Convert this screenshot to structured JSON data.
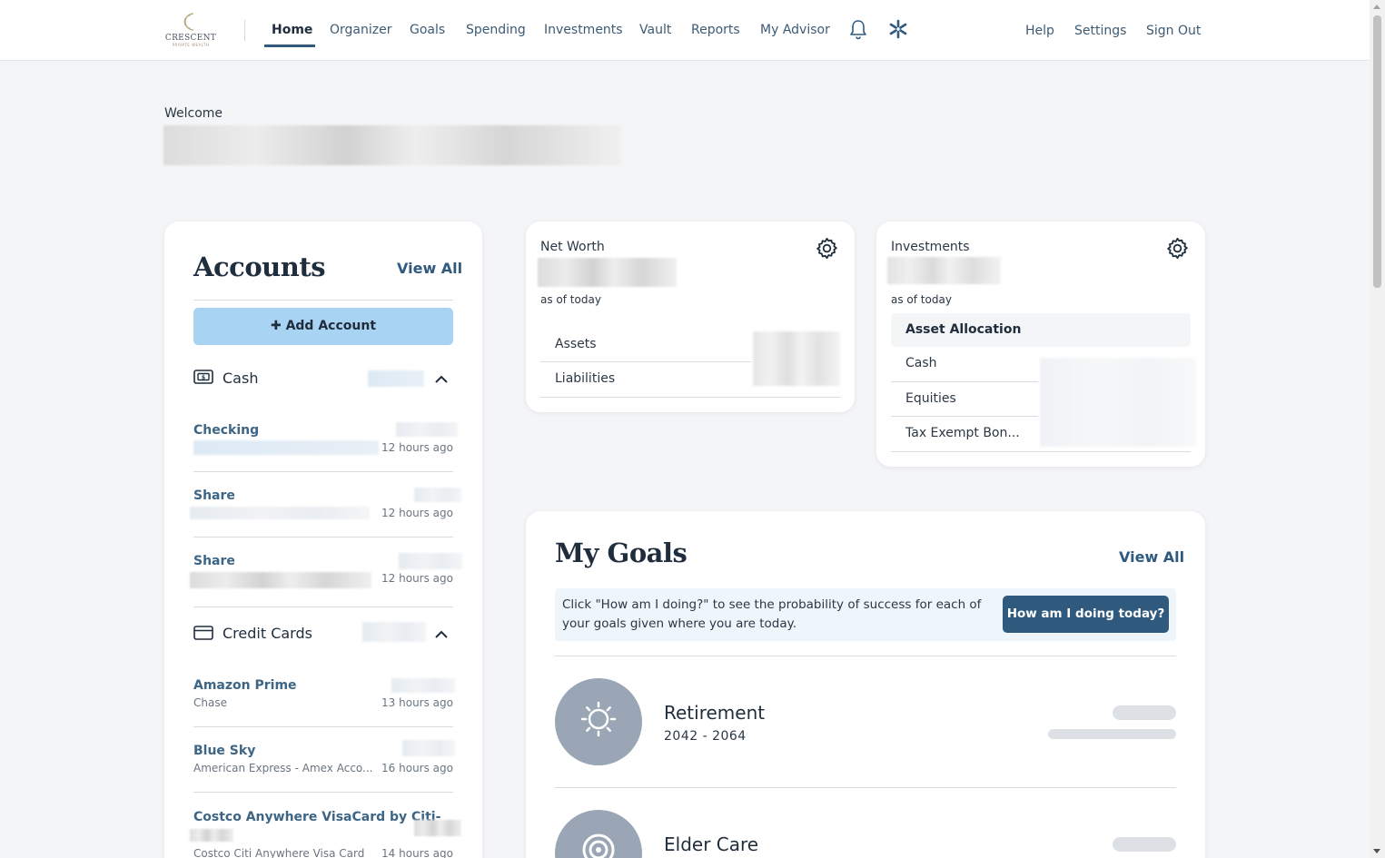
{
  "nav": {
    "logo_text": "CRESCENT",
    "logo_sub": "PRIVATE WEALTH",
    "items": [
      {
        "label": "Home"
      },
      {
        "label": "Organizer"
      },
      {
        "label": "Goals"
      },
      {
        "label": "Spending"
      },
      {
        "label": "Investments"
      },
      {
        "label": "Vault"
      },
      {
        "label": "Reports"
      },
      {
        "label": "My Advisor"
      }
    ],
    "right": [
      {
        "label": "Help"
      },
      {
        "label": "Settings"
      },
      {
        "label": "Sign Out"
      }
    ],
    "icons": [
      "bell-icon",
      "asterisk-icon"
    ]
  },
  "welcome": {
    "label": "Welcome"
  },
  "accounts": {
    "title": "Accounts",
    "view_all": "View All",
    "add_label": "Add Account",
    "groups": [
      {
        "name": "Cash",
        "items": [
          {
            "name": "Checking",
            "time": "12 hours ago"
          },
          {
            "name": "Share",
            "time": "12 hours ago"
          },
          {
            "name": "Share",
            "time": "12 hours ago"
          }
        ]
      },
      {
        "name": "Credit Cards",
        "items": [
          {
            "name": "Amazon Prime",
            "sub": "Chase",
            "time": "13 hours ago"
          },
          {
            "name": "Blue Sky",
            "sub": "American Express - Amex Acco...",
            "time": "16 hours ago"
          },
          {
            "name": "Costco Anywhere VisaCard by Citi-",
            "sub": "Costco Citi Anywhere Visa Card",
            "time": "14 hours ago"
          }
        ]
      }
    ]
  },
  "networth": {
    "label": "Net Worth",
    "as_of": "as of today",
    "rows": [
      "Assets",
      "Liabilities"
    ]
  },
  "investments": {
    "label": "Investments",
    "as_of": "as of today",
    "allocation_header": "Asset Allocation",
    "rows": [
      "Cash",
      "Equities",
      "Tax Exempt Bon..."
    ]
  },
  "goals": {
    "title": "My Goals",
    "view_all": "View All",
    "info_text": "Click \"How am I doing?\" to see the probability of success for each of your goals given where you are today.",
    "button": "How am I doing today?",
    "items": [
      {
        "name": "Retirement",
        "years": "2042 - 2064",
        "icon": "sun-icon"
      },
      {
        "name": "Elder Care",
        "years": "",
        "icon": "target-icon"
      }
    ]
  },
  "colors": {
    "accent": "#2f5a7e",
    "add_button": "#a9d3f2",
    "goal_circle": "#9aa6b5"
  }
}
